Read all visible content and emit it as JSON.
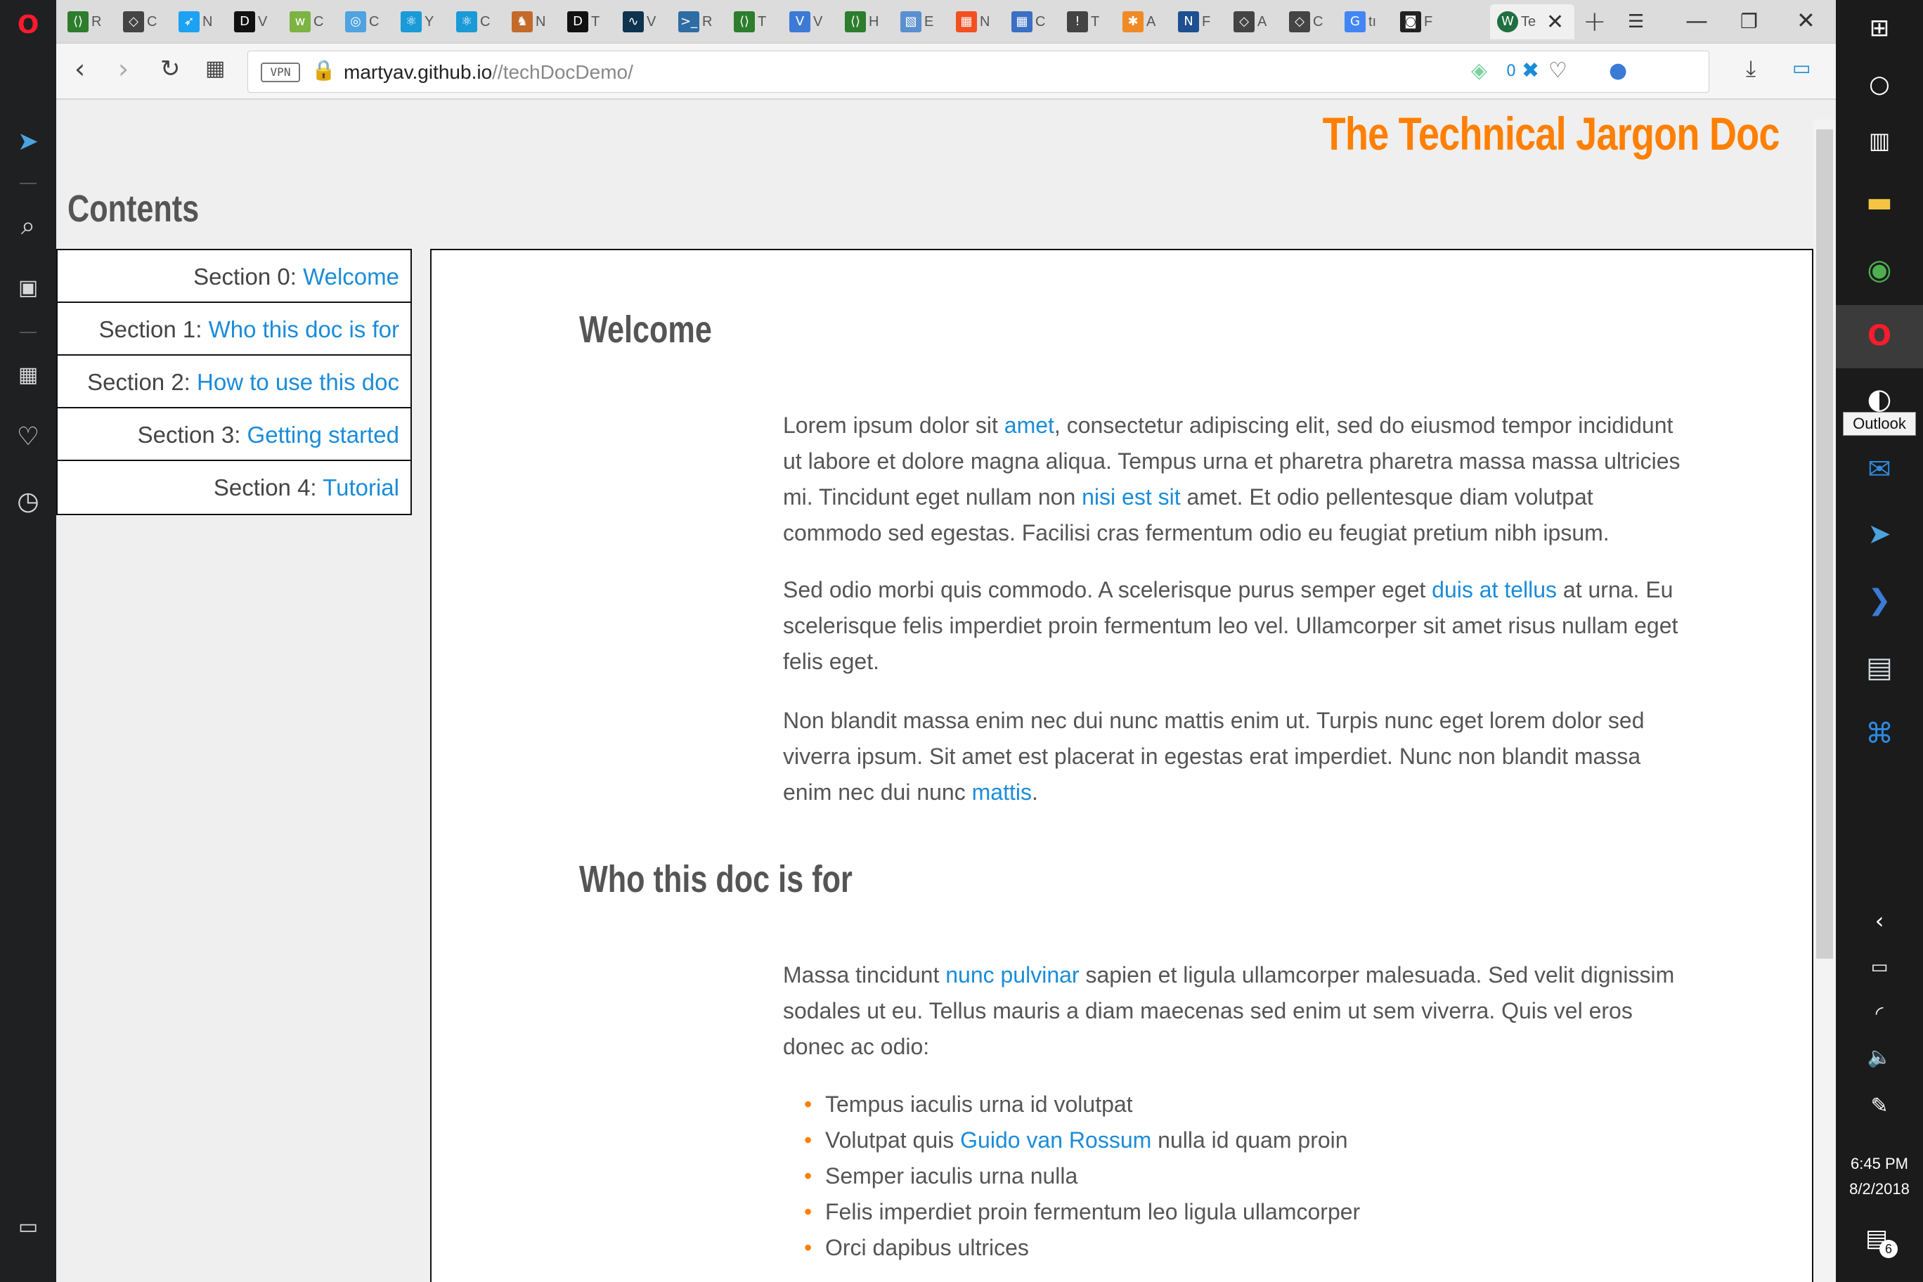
{
  "browser": {
    "tabs": [
      {
        "icon": "code-icon",
        "letter": "R",
        "color": "#2d7d2d"
      },
      {
        "icon": "codepen-icon",
        "letter": "C",
        "color": "#444444"
      },
      {
        "icon": "bird-icon",
        "letter": "N",
        "color": "#1da1f2"
      },
      {
        "icon": "dev-icon",
        "letter": "V",
        "color": "#111111"
      },
      {
        "icon": "web-icon",
        "letter": "C",
        "color": "#7cb342"
      },
      {
        "icon": "cd-icon",
        "letter": "C",
        "color": "#4fa3e0"
      },
      {
        "icon": "react-icon",
        "letter": "Y",
        "color": "#1a9ad6"
      },
      {
        "icon": "react-icon",
        "letter": "C",
        "color": "#1a9ad6"
      },
      {
        "icon": "figure-icon",
        "letter": "N",
        "color": "#c46a2a"
      },
      {
        "icon": "dev-icon",
        "letter": "T",
        "color": "#111111"
      },
      {
        "icon": "pulse-icon",
        "letter": "V",
        "color": "#0d3350"
      },
      {
        "icon": "terminal-icon",
        "letter": "R",
        "color": "#2e6da4"
      },
      {
        "icon": "code-icon",
        "letter": "T",
        "color": "#2d7d2d"
      },
      {
        "icon": "v-icon",
        "letter": "V",
        "color": "#3d7ad6"
      },
      {
        "icon": "code-icon",
        "letter": "H",
        "color": "#2d7d2d"
      },
      {
        "icon": "map-icon",
        "letter": "E",
        "color": "#5a8fd0"
      },
      {
        "icon": "microsoft-icon",
        "letter": "N",
        "color": "#f25022"
      },
      {
        "icon": "grid-icon",
        "letter": "C",
        "color": "#3a6fc4"
      },
      {
        "icon": "pin-icon",
        "letter": "T",
        "color": "#444444"
      },
      {
        "icon": "asterisk-icon",
        "letter": "A",
        "color": "#f08a24"
      },
      {
        "icon": "nyc-icon",
        "letter": "F",
        "color": "#1d4f91"
      },
      {
        "icon": "codepen-icon",
        "letter": "A",
        "color": "#444444"
      },
      {
        "icon": "codepen-icon",
        "letter": "C",
        "color": "#444444"
      },
      {
        "icon": "google-icon",
        "letter": "tı",
        "color": "#4285f4"
      },
      {
        "icon": "camera-icon",
        "letter": "F",
        "color": "#222222"
      }
    ],
    "active_tab": {
      "icon": "wordpress-icon",
      "letter": "Te"
    },
    "address": {
      "vpn_label": "VPN",
      "url_host": "martyav.github.io",
      "url_path": "//techDocDemo/",
      "badge_count": "0"
    }
  },
  "page": {
    "doc_title": "The Technical Jargon Doc",
    "contents_heading": "Contents",
    "toc": [
      {
        "prefix": "Section 0: ",
        "link": "Welcome"
      },
      {
        "prefix": "Section 1: ",
        "link": "Who this doc is for"
      },
      {
        "prefix": "Section 2: ",
        "link": "How to use this doc"
      },
      {
        "prefix": "Section 3: ",
        "link": "Getting started"
      },
      {
        "prefix": "Section 4: ",
        "link": "Tutorial"
      }
    ],
    "welcome": {
      "heading": "Welcome",
      "p1": {
        "a": "Lorem ipsum dolor sit ",
        "link1": "amet",
        "b": ", consectetur adipiscing elit, sed do eiusmod tempor incididunt ut labore et dolore magna aliqua. Tempus urna et pharetra pharetra massa massa ultricies mi. Tincidunt eget nullam non ",
        "link2": "nisi est sit",
        "c": " amet. Et odio pellentesque diam volutpat commodo sed egestas. Facilisi cras fermentum odio eu feugiat pretium nibh ipsum."
      },
      "p2": {
        "a": "Sed odio morbi quis commodo. A scelerisque purus semper eget ",
        "link": "duis at tellus",
        "b": " at urna. Eu scelerisque felis imperdiet proin fermentum leo vel. Ullamcorper sit amet risus nullam eget felis eget."
      },
      "p3": {
        "a": "Non blandit massa enim nec dui nunc mattis enim ut. Turpis nunc eget lorem dolor sed viverra ipsum. Sit amet est placerat in egestas erat imperdiet. Nunc non blandit massa enim nec dui nunc ",
        "link": "mattis",
        "b": "."
      }
    },
    "who": {
      "heading": "Who this doc is for",
      "p1": {
        "a": "Massa tincidunt ",
        "link": "nunc pulvinar",
        "b": " sapien et ligula ullamcorper malesuada. Sed velit dignissim sodales ut eu. Tellus mauris a diam maecenas sed enim ut sem viverra. Quis vel eros donec ac odio:"
      },
      "list": {
        "i1": "Tempus iaculis urna id volutpat",
        "i2a": "Volutpat quis ",
        "i2link": "Guido van Rossum",
        "i2b": " nulla id quam proin",
        "i3": "Semper iaculis urna nulla",
        "i4": "Felis imperdiet proin fermentum leo ligula ullamcorper",
        "i5": "Orci dapibus ultrices"
      }
    }
  },
  "taskbar": {
    "tooltip": "Outlook",
    "time": "6:45 PM",
    "date": "8/2/2018",
    "notification_count": "6"
  },
  "colors": {
    "accent": "#ff7f00",
    "link": "#1a8cd8",
    "text": "#555555"
  }
}
